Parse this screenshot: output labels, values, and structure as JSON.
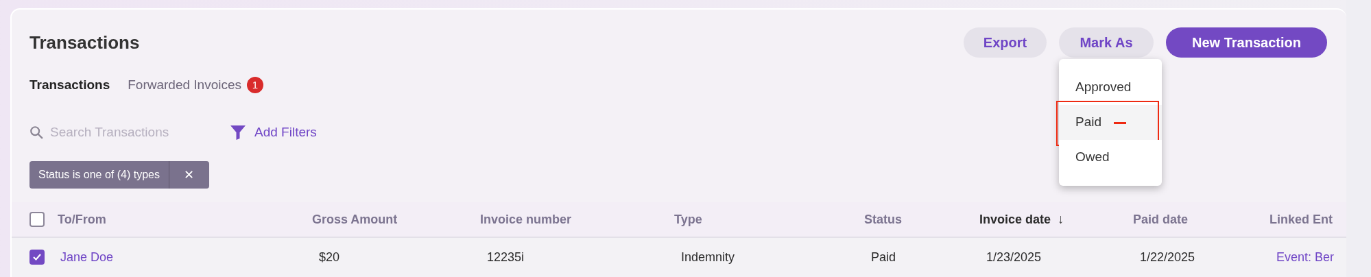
{
  "page": {
    "title": "Transactions"
  },
  "actions": [
    {
      "label": "Export",
      "kind": "secondary"
    },
    {
      "label": "Mark As",
      "kind": "secondary",
      "expanded": true
    },
    {
      "label": "New Transaction",
      "kind": "primary"
    }
  ],
  "mark_as_menu": [
    {
      "label": "Approved",
      "highlighted": false,
      "annotated": false
    },
    {
      "label": "Paid",
      "highlighted": true,
      "annotated": true
    },
    {
      "label": "Owed",
      "highlighted": false,
      "annotated": false
    }
  ],
  "tabs": [
    {
      "label": "Transactions",
      "selected": true
    },
    {
      "label": "Forwarded Invoices",
      "selected": false,
      "badge": "1"
    }
  ],
  "search": {
    "placeholder": "Search Transactions"
  },
  "add_filters": "Add Filters",
  "filter_chips": [
    {
      "label": "Status is one of (4) types",
      "close": "✕"
    }
  ],
  "table": {
    "select_all_checked": false,
    "columns": [
      {
        "label": "To/From",
        "sorted": false
      },
      {
        "label": "Gross Amount",
        "sorted": false
      },
      {
        "label": "Invoice number",
        "sorted": false
      },
      {
        "label": "Type",
        "sorted": false
      },
      {
        "label": "Status",
        "sorted": false
      },
      {
        "label": "Invoice date",
        "sorted": true,
        "sort_arrow": "↓"
      },
      {
        "label": "Paid date",
        "sorted": false
      },
      {
        "label": "Linked Ent",
        "sorted": false
      }
    ],
    "rows": [
      {
        "checked": true,
        "cells": [
          {
            "text": "Jane Doe",
            "kind": "link"
          },
          {
            "text": "$20",
            "kind": "text"
          },
          {
            "text": "12235i",
            "kind": "text"
          },
          {
            "text": "Indemnity",
            "kind": "text"
          },
          {
            "text": "Paid",
            "kind": "text"
          },
          {
            "text": "1/23/2025",
            "kind": "text"
          },
          {
            "text": "1/22/2025",
            "kind": "text"
          },
          {
            "text": "Event: Ber",
            "kind": "link"
          }
        ]
      }
    ]
  }
}
